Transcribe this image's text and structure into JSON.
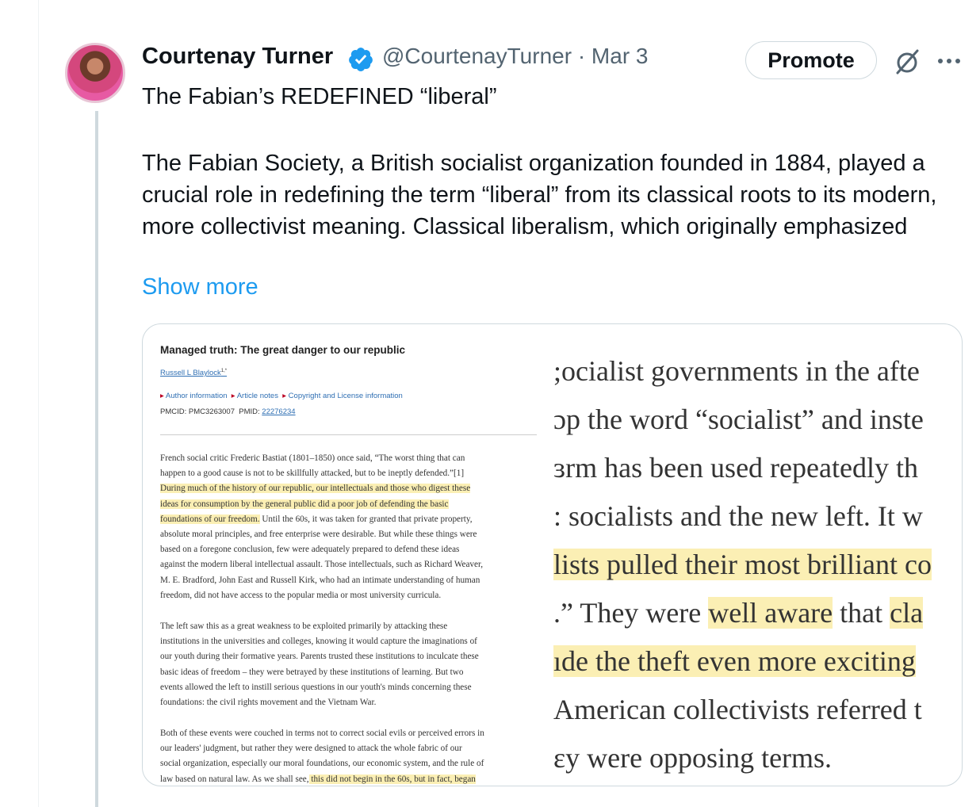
{
  "tweet": {
    "author_name": "Courtenay Turner",
    "handle_date": "@CourtenayTurner · Mar 3",
    "promote_label": "Promote",
    "headline": "The Fabian’s REDEFINED “liberal”",
    "body": "The Fabian Society, a British socialist organization founded in 1884, played a crucial role in redefining the term “liberal” from its classical roots to its modern, more collectivist meaning. Classical liberalism, which originally emphasized",
    "show_more": "Show more",
    "colors": {
      "accent": "#1d9bf0",
      "text": "#0f1419",
      "secondary": "#536471",
      "highlight": "#fbefb4"
    },
    "icons": [
      "verified-badge-icon",
      "grok-icon",
      "more-options-icon"
    ]
  },
  "media": {
    "left": {
      "title": "Managed truth: The great danger to our republic",
      "author": "Russell L Blaylock",
      "author_sup": "1,*",
      "links": [
        "Author information",
        "Article notes",
        "Copyright and License information"
      ],
      "pmcid": "PMCID: PMC3263007",
      "pmid_label": "PMID:",
      "pmid": "22276234",
      "p1": [
        "French social critic Frederic Bastiat (1801–1850) once said, “The worst thing that can",
        "happen to a good cause is not to be skillfully attacked, but to be ineptly defended.”[1]",
        "During much of the history of our republic, our intellectuals and those who digest these",
        "ideas for consumption by the general public did a poor job of defending the basic",
        "foundations of our freedom.",
        " Until the 60s, it was taken for granted that private property,",
        "absolute moral principles, and free enterprise were desirable. But while these things were",
        "based on a foregone conclusion, few were adequately prepared to defend these ideas",
        "against the modern liberal intellectual assault. Those intellectuals, such as Richard Weaver,",
        "M. E. Bradford, John East and Russell Kirk, who had an intimate understanding of human",
        "freedom, did not have access to the popular media or most university curricula."
      ],
      "p2": [
        "The left saw this as a great weakness to be exploited primarily by attacking these",
        "institutions in the universities and colleges, knowing it would capture the imaginations of",
        "our youth during their formative years. Parents trusted these institutions to inculcate these",
        "basic ideas of freedom – they were betrayed by these institutions of learning. But two",
        "events allowed the left to instill serious questions in our youth's minds concerning these",
        "foundations: the civil rights movement and the Vietnam War."
      ],
      "p3": [
        "Both of these events were couched in terms not to correct social evils or perceived errors in",
        "our leaders' judgment, but rather they were designed to attack the whole fabric of our",
        "social organization, especially our moral foundations, our economic system, and the rule of",
        "law based on natural law. As we shall see,",
        " this did not begin in the 60s, but in fact, began"
      ]
    },
    "right": {
      "lines": [
        ";ocialist governments in the afte",
        "ɔp the word “socialist” and inste",
        "ɜrm has been used repeatedly th",
        ": socialists and the new left. It w",
        "lists pulled their most brilliant co",
        ".” They were ",
        "well aware",
        " that ",
        "cla",
        "ıde the theft even more exciting",
        "American collectivists referred t",
        "ɛy were opposing terms."
      ]
    }
  }
}
